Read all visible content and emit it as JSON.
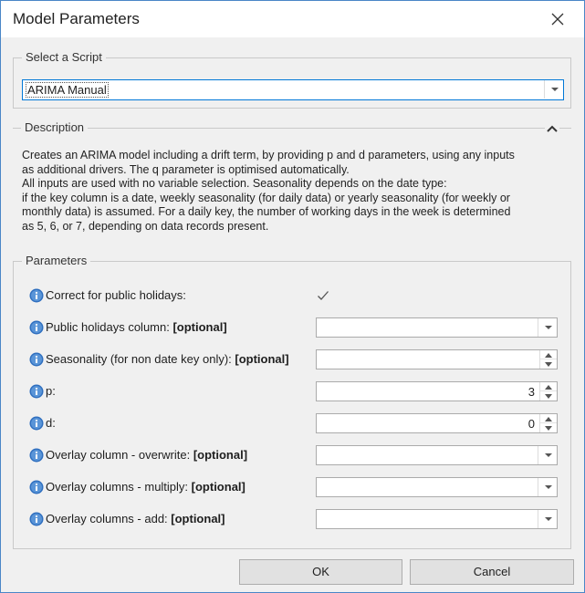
{
  "window": {
    "title": "Model Parameters"
  },
  "script_group": {
    "legend": "Select a Script",
    "selected": "ARIMA Manual"
  },
  "description_group": {
    "legend": "Description",
    "lines": [
      "Creates an ARIMA model including a drift term, by providing p and d parameters, using any inputs",
      "as additional drivers.  The q parameter is optimised automatically.",
      "All inputs are used with no variable selection. Seasonality depends on the date type:",
      "if the key column is a date, weekly seasonality (for daily data) or yearly seasonality (for weekly or",
      "monthly data) is assumed. For a daily key, the number of working days in the week is determined",
      "as 5, 6, or 7, depending on data records present."
    ]
  },
  "parameters_group": {
    "legend": "Parameters",
    "rows": [
      {
        "label": "Correct for public holidays:",
        "optional": "",
        "control": "checkbox",
        "checked": true
      },
      {
        "label": "Public holidays column: ",
        "optional": "[optional]",
        "control": "combo",
        "value": ""
      },
      {
        "label": "Seasonality (for non date key only): ",
        "optional": "[optional]",
        "control": "spin",
        "value": ""
      },
      {
        "label": "p:",
        "optional": "",
        "control": "spin",
        "value": "3"
      },
      {
        "label": "d:",
        "optional": "",
        "control": "spin",
        "value": "0"
      },
      {
        "label": "Overlay column - overwrite: ",
        "optional": "[optional]",
        "control": "combo",
        "value": ""
      },
      {
        "label": "Overlay columns - multiply: ",
        "optional": "[optional]",
        "control": "combo",
        "value": ""
      },
      {
        "label": "Overlay columns - add: ",
        "optional": "[optional]",
        "control": "combo",
        "value": ""
      }
    ]
  },
  "buttons": {
    "ok": "OK",
    "cancel": "Cancel"
  },
  "icons": {
    "close": "close-icon",
    "collapse": "chevron-up-icon",
    "info": "info-icon",
    "dropdown": "chevron-down-icon",
    "spin_up": "spin-up-icon",
    "spin_down": "spin-down-icon",
    "check": "check-icon"
  },
  "colors": {
    "window_border": "#4a86c7",
    "info_icon": "#2f6fbf",
    "focus_border": "#0078d7"
  }
}
